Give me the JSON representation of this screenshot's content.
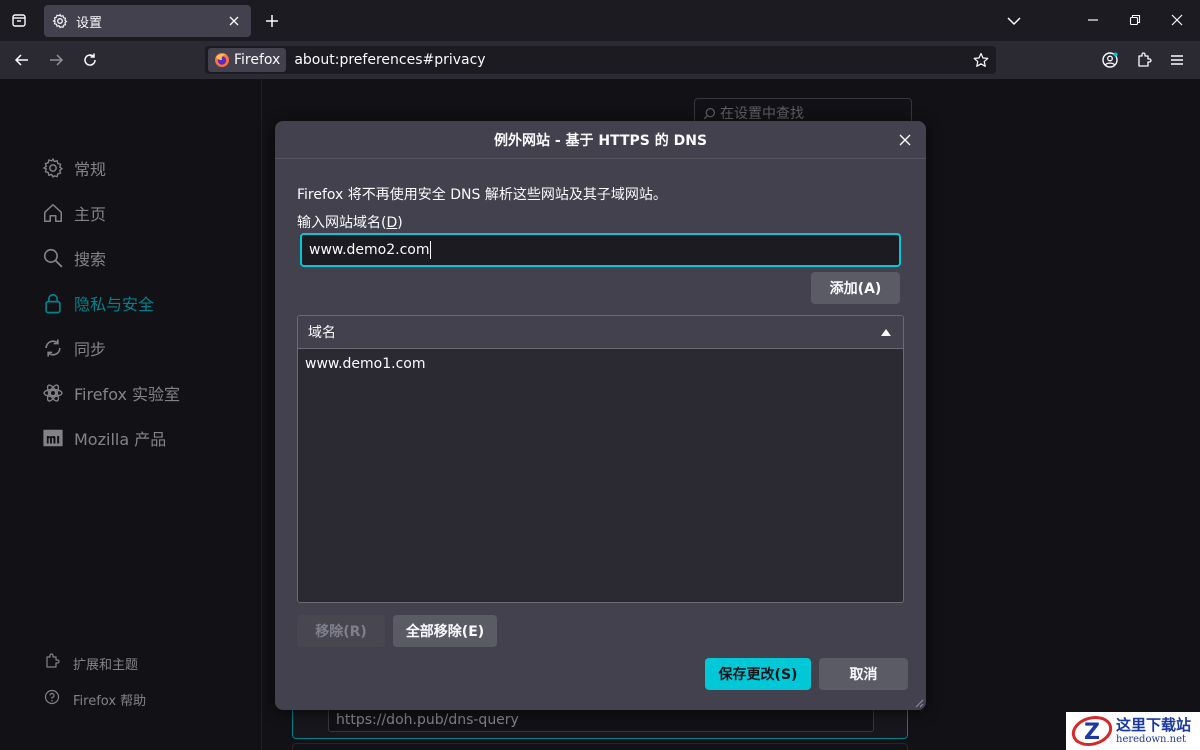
{
  "colors": {
    "accent": "#00c8d7",
    "dialog_bg": "#42414d",
    "page_bg": "#1c1b22",
    "toolbar_bg": "#2b2a33"
  },
  "tab": {
    "title": "设置",
    "icon": "gear-icon"
  },
  "navbar": {
    "identity_label": "Firefox",
    "url": "about:preferences#privacy"
  },
  "sidebar": {
    "items": [
      {
        "label": "常规",
        "icon": "gear-icon"
      },
      {
        "label": "主页",
        "icon": "home-icon"
      },
      {
        "label": "搜索",
        "icon": "search-icon"
      },
      {
        "label": "隐私与安全",
        "icon": "lock-icon"
      },
      {
        "label": "同步",
        "icon": "sync-icon"
      },
      {
        "label": "Firefox 实验室",
        "icon": "flask-icon"
      },
      {
        "label": "Mozilla 产品",
        "icon": "mozilla-icon"
      }
    ],
    "selected": "隐私与安全",
    "footer": [
      {
        "label": "扩展和主题",
        "icon": "puzzle-icon"
      },
      {
        "label": "Firefox 帮助",
        "icon": "help-icon"
      }
    ]
  },
  "search": {
    "placeholder": "在设置中查找"
  },
  "background": {
    "provider_url": "https://doh.pub/dns-query"
  },
  "dialog": {
    "title": "例外网站 - 基于 HTTPS 的 DNS",
    "description": "Firefox 将不再使用安全 DNS 解析这些网站及其子域网站。",
    "input_label": "输入网站域名(",
    "input_label_key": "D",
    "input_label_end": ")",
    "input_value": "www.demo2.com",
    "add_button": "添加(A)",
    "column_header": "域名",
    "domains": [
      "www.demo1.com"
    ],
    "remove_button": "移除(R)",
    "remove_all_button": "全部移除(E)",
    "save_button": "保存更改(S)",
    "cancel_button": "取消"
  },
  "watermark": {
    "title": "这里下载站",
    "subtitle": "heredown.net",
    "logo_text": "Z"
  }
}
